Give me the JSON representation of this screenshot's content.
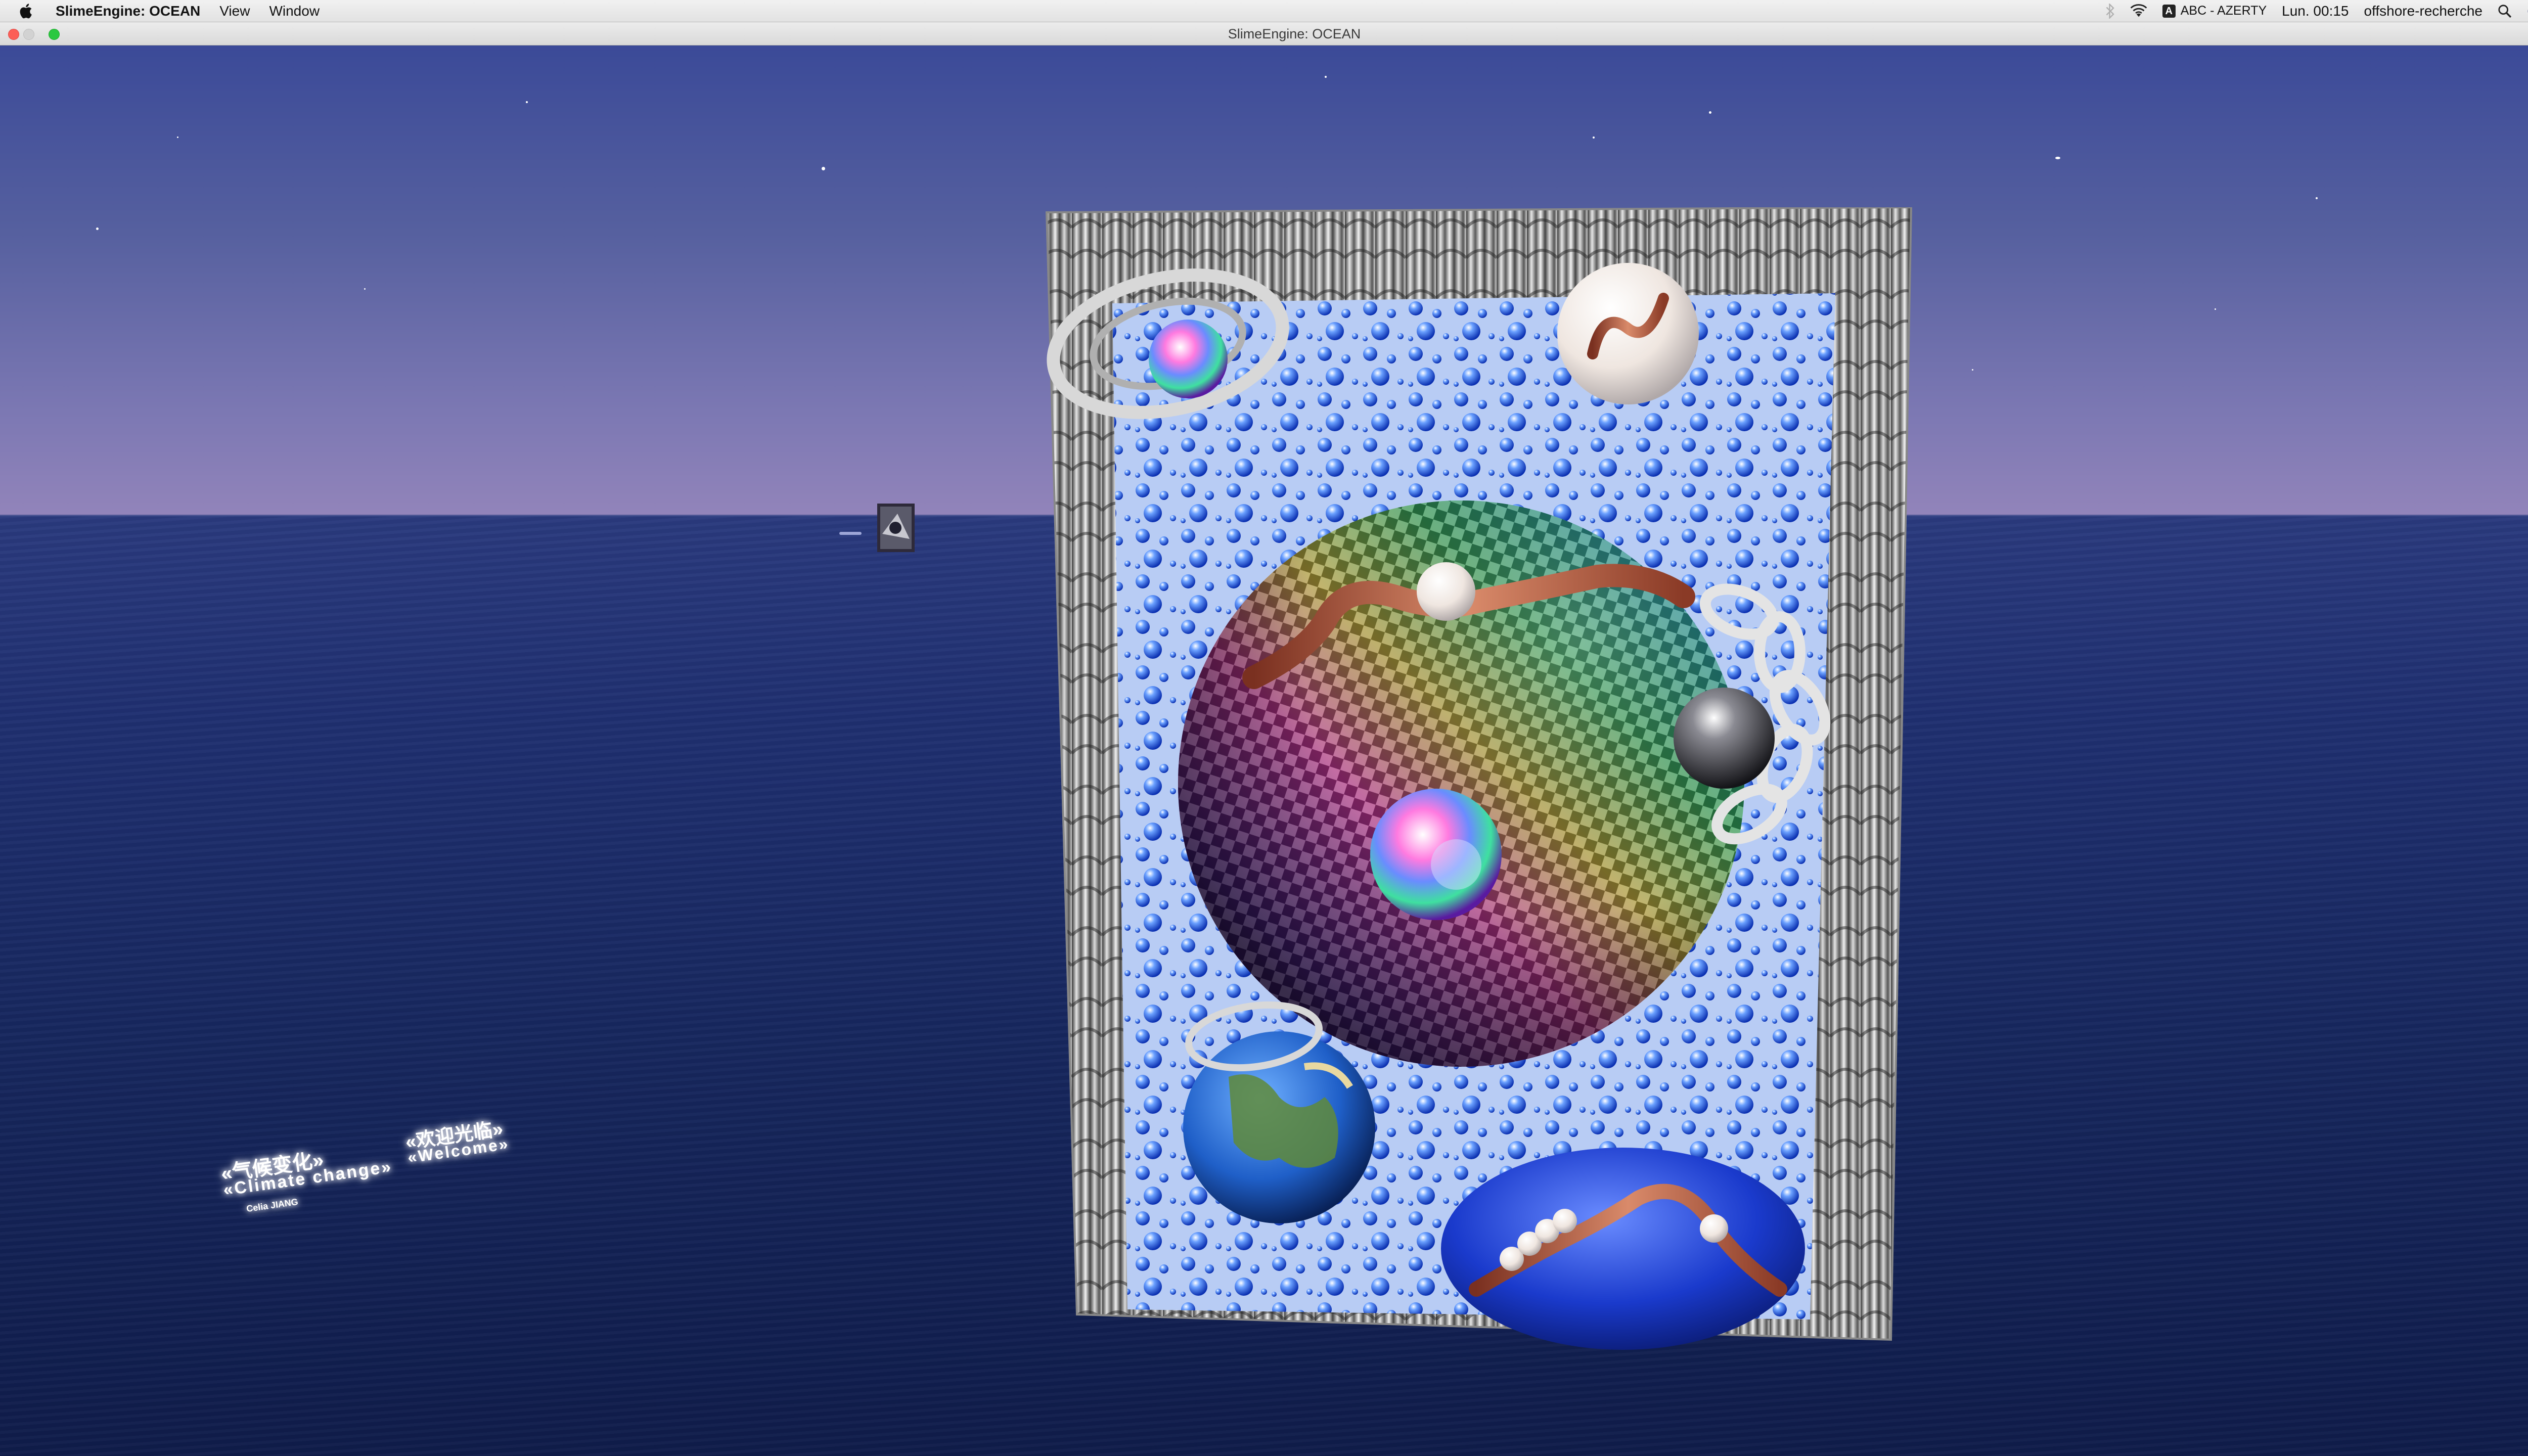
{
  "menubar": {
    "app_name": "SlimeEngine: OCEAN",
    "menus": [
      "View",
      "Window"
    ],
    "status": {
      "input_source_badge": "A",
      "input_source": "ABC - AZERTY",
      "clock": "Lun. 00:15",
      "user": "offshore-recherche"
    },
    "icons": [
      "apple-icon",
      "bluetooth-icon",
      "wifi-icon",
      "search-icon",
      "siri-icon",
      "notification-center-icon"
    ]
  },
  "window": {
    "title": "SlimeEngine: OCEAN"
  },
  "scene": {
    "sign": {
      "line1_left": "«气候变化»",
      "line2_left": "«Climate change»",
      "credit": "Celia JIANG",
      "line1_right": "«欢迎光临»",
      "line2_right": "«Welcome»"
    }
  },
  "colors": {
    "sky_top": "#3b4a98",
    "sky_horizon": "#9284ba",
    "sea": "#17275e",
    "close": "#fc5f57",
    "zoom": "#2bc840"
  }
}
